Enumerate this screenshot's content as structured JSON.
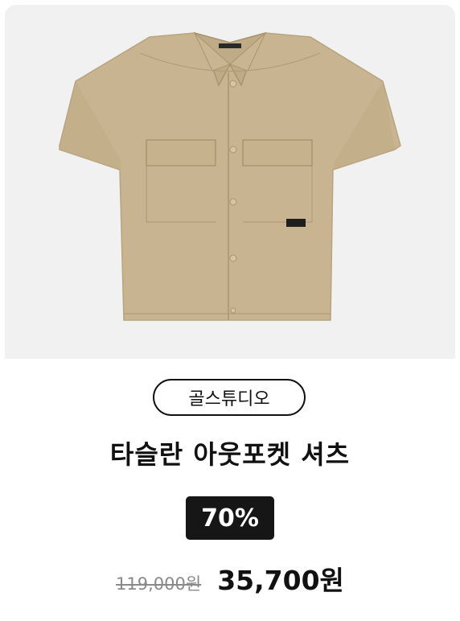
{
  "product": {
    "image_alt": "beige short sleeve outpocket shirt",
    "brand": "골스튜디오",
    "name": "타슬란 아웃포켓 셔츠",
    "discount": "70%",
    "original_price": "119,000원",
    "sale_price": "35,700원"
  },
  "colors": {
    "shirt": "#c8b490",
    "image_bg": "#f1f1f1",
    "badge_bg": "#161616"
  }
}
